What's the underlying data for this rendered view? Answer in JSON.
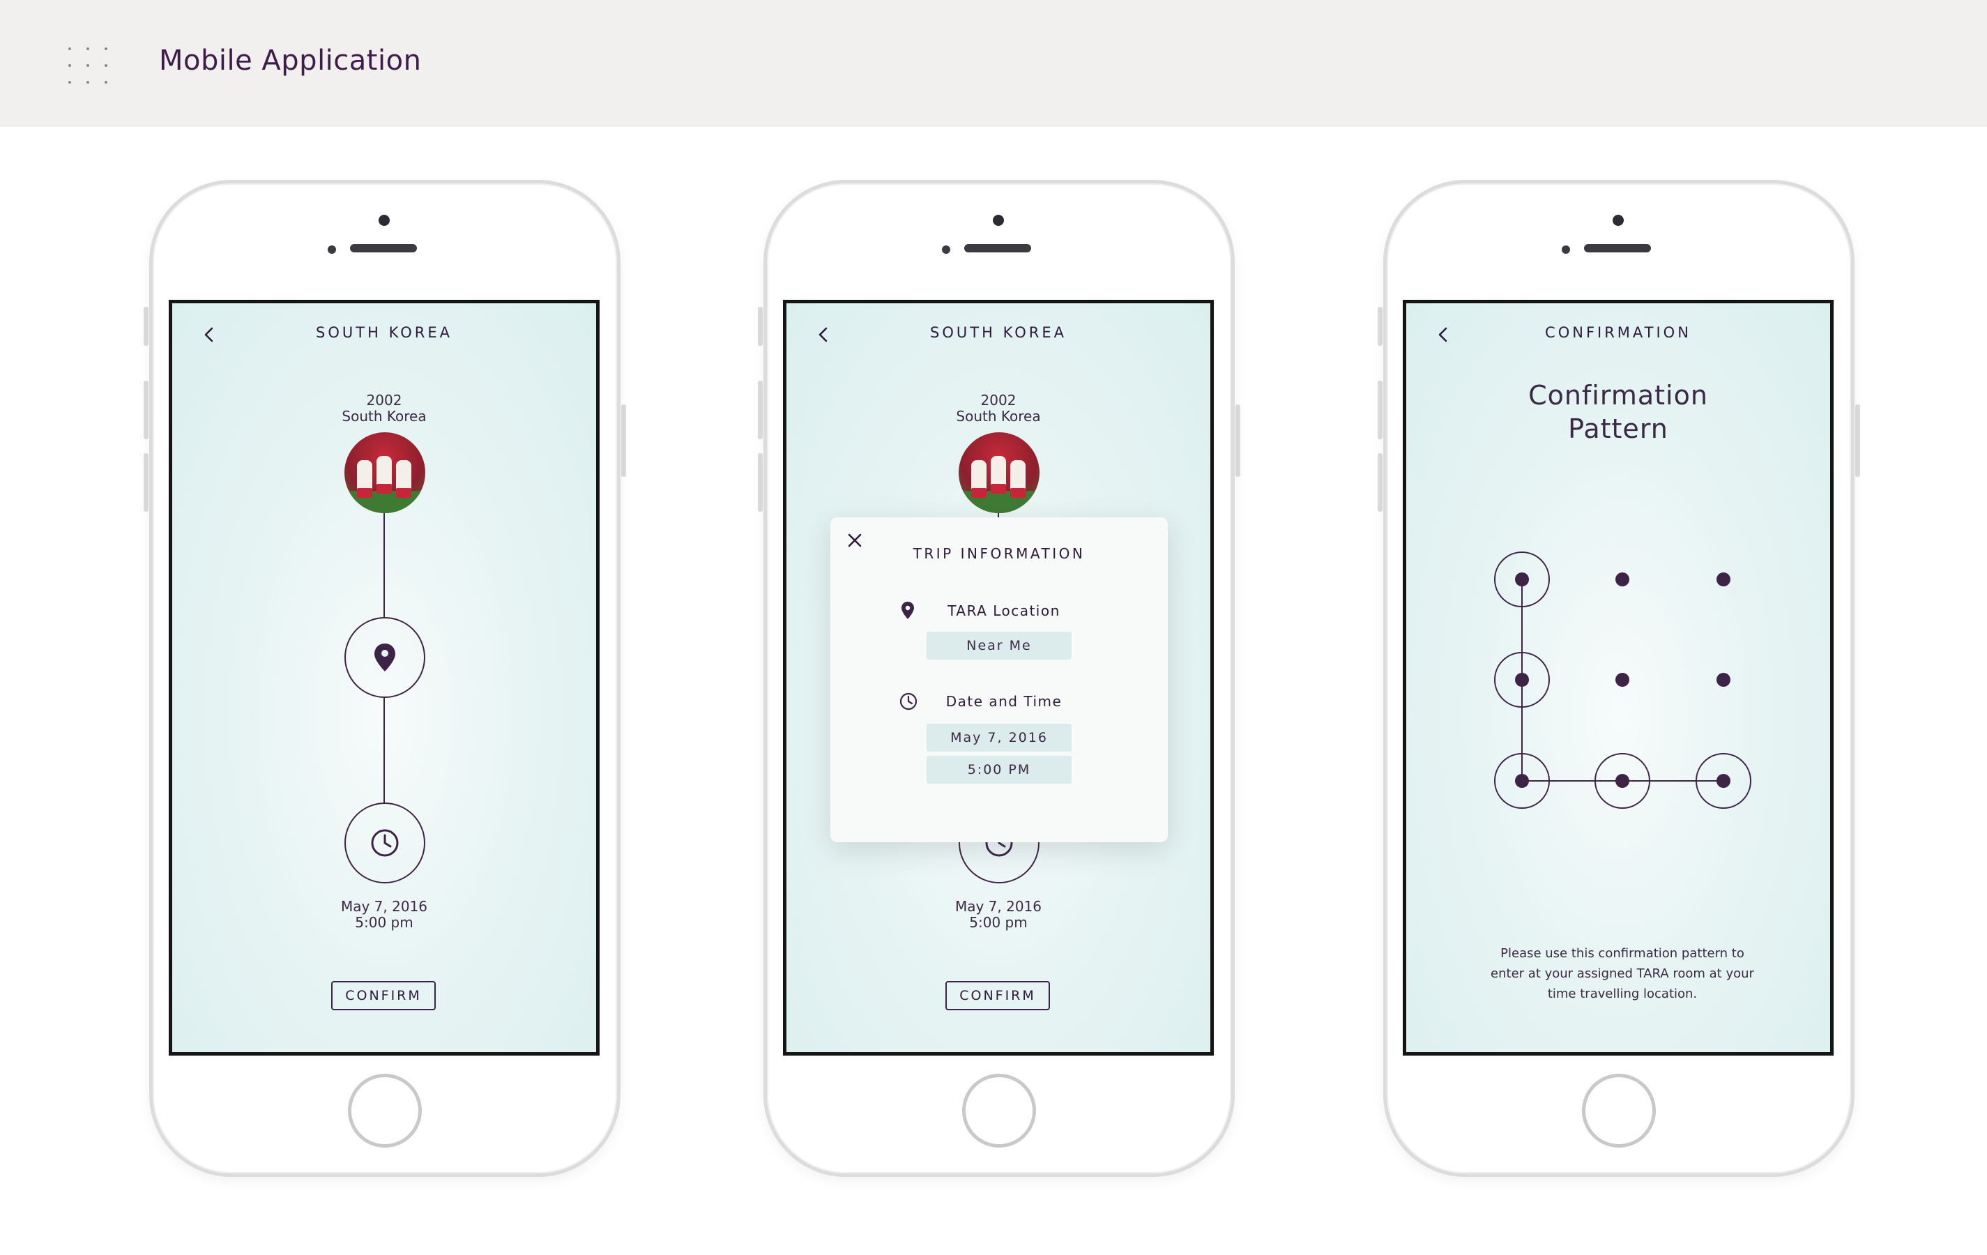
{
  "header": {
    "title": "Mobile Application"
  },
  "phones": [
    {
      "screen_title": "SOUTH KOREA",
      "year": "2002",
      "country": "South Korea",
      "date": "May 7, 2016",
      "time": "5:00 pm",
      "confirm_label": "CONFIRM"
    },
    {
      "screen_title": "SOUTH KOREA",
      "year": "2002",
      "country": "South Korea",
      "date": "May 7, 2016",
      "time": "5:00 pm",
      "confirm_label": "CONFIRM",
      "modal": {
        "title": "TRIP INFORMATION",
        "location_label": "TARA Location",
        "location_value": "Near Me",
        "datetime_label": "Date and Time",
        "date_value": "May 7, 2016",
        "time_value": "5:00 PM"
      }
    },
    {
      "screen_title": "CONFIRMATION",
      "heading_line1": "Confirmation",
      "heading_line2": "Pattern",
      "note": "Please use this confirmation pattern to enter at your assigned TARA room at your time travelling location."
    }
  ],
  "icons": {
    "back": "chevron-left-icon",
    "location": "map-pin-icon",
    "time": "clock-icon",
    "close": "close-icon",
    "menu": "dot-grid-icon"
  },
  "colors": {
    "accent": "#3d2447",
    "screen_bg": "#e3f1f1",
    "header_bg": "#f1f0ef",
    "field_bg": "#dcecec"
  }
}
